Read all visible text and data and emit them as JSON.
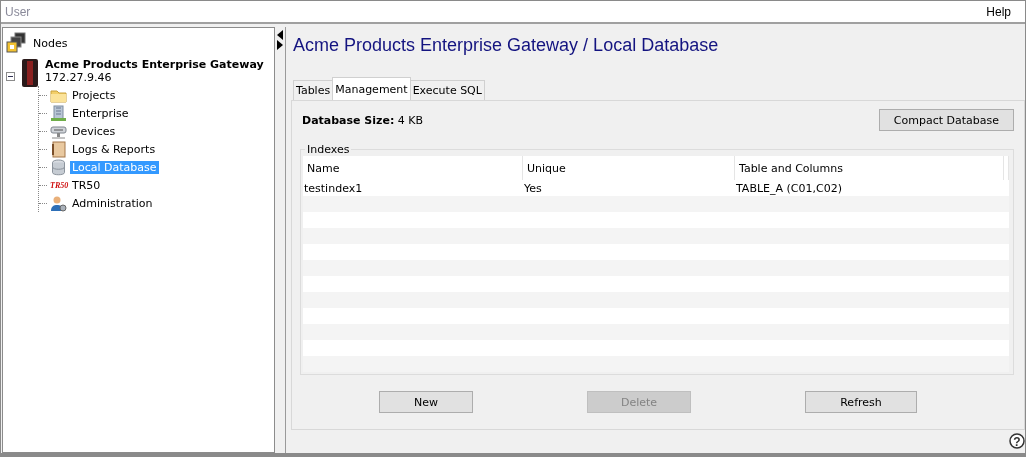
{
  "menu_bar": {
    "items": [
      {
        "label": "User",
        "disabled": true
      },
      {
        "label": "Help",
        "disabled": false
      }
    ]
  },
  "tree": {
    "label": "Nodes",
    "children": [
      {
        "label": "Acme Products Enterprise Gateway",
        "sublabel": "172.27.9.46",
        "expanded": true,
        "children": [
          {
            "label": "Projects",
            "kind": "folder",
            "selected": false
          },
          {
            "label": "Enterprise",
            "kind": "building",
            "selected": false
          },
          {
            "label": "Devices",
            "kind": "device",
            "selected": false
          },
          {
            "label": "Logs & Reports",
            "kind": "log",
            "selected": false
          },
          {
            "label": "Local Database",
            "kind": "database",
            "selected": true
          },
          {
            "label": "TR50",
            "kind": "logo",
            "logo_text": "TR50",
            "selected": false
          },
          {
            "label": "Administration",
            "kind": "admin",
            "selected": false
          }
        ]
      }
    ]
  },
  "main": {
    "title": "Acme Products Enterprise Gateway / Local Database",
    "tabs": [
      {
        "label": "Tables",
        "selected": false
      },
      {
        "label": "Management",
        "selected": true
      },
      {
        "label": "Execute SQL",
        "selected": false
      }
    ],
    "size_label": "Database Size:",
    "size_value": "4 KB",
    "compact_button": "Compact Database",
    "indexes": {
      "label": "Indexes",
      "columns": [
        "Name",
        "Unique",
        "Table and Columns"
      ],
      "rows": [
        [
          "testindex1",
          "Yes",
          "TABLE_A (C01,C02)"
        ]
      ]
    },
    "buttons": [
      {
        "label": "New",
        "disabled": false
      },
      {
        "label": "Delete",
        "disabled": true
      },
      {
        "label": "Refresh",
        "disabled": false
      }
    ],
    "help_glyph": "?"
  }
}
